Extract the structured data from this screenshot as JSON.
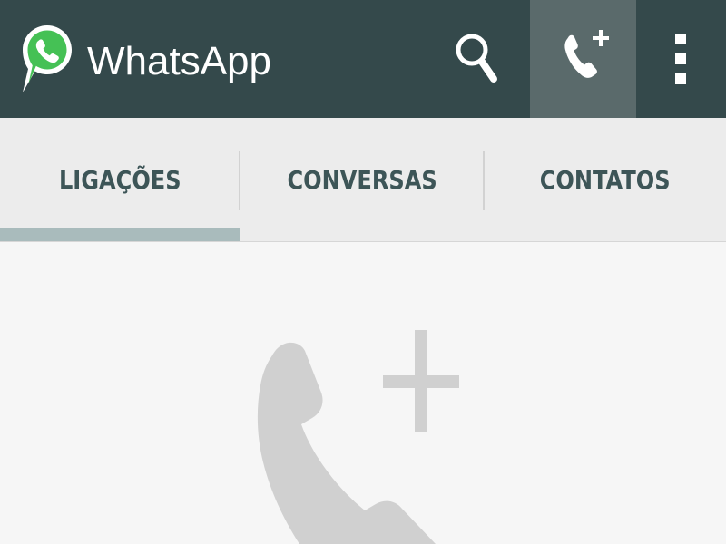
{
  "action_bar": {
    "title": "WhatsApp",
    "logo_icon": "whatsapp-logo-icon",
    "actions": [
      {
        "name": "search",
        "icon": "search-icon"
      },
      {
        "name": "new-call",
        "icon": "add-call-icon"
      },
      {
        "name": "more-options",
        "icon": "overflow-menu-icon"
      }
    ]
  },
  "tabs": [
    {
      "label": "LIGAÇÕES",
      "selected": true
    },
    {
      "label": "CONVERSAS",
      "selected": false
    },
    {
      "label": "CONTATOS",
      "selected": false
    }
  ],
  "content": {
    "empty_state_icon": "add-call-icon"
  },
  "colors": {
    "toolbar": "#34494b",
    "toolbar_active": "#5a6a6b",
    "tab_background": "#ececec",
    "tab_text": "#3d5557",
    "tab_indicator": "#a9bbbc",
    "content_background": "#f6f6f6",
    "brand_green": "#45c155"
  }
}
